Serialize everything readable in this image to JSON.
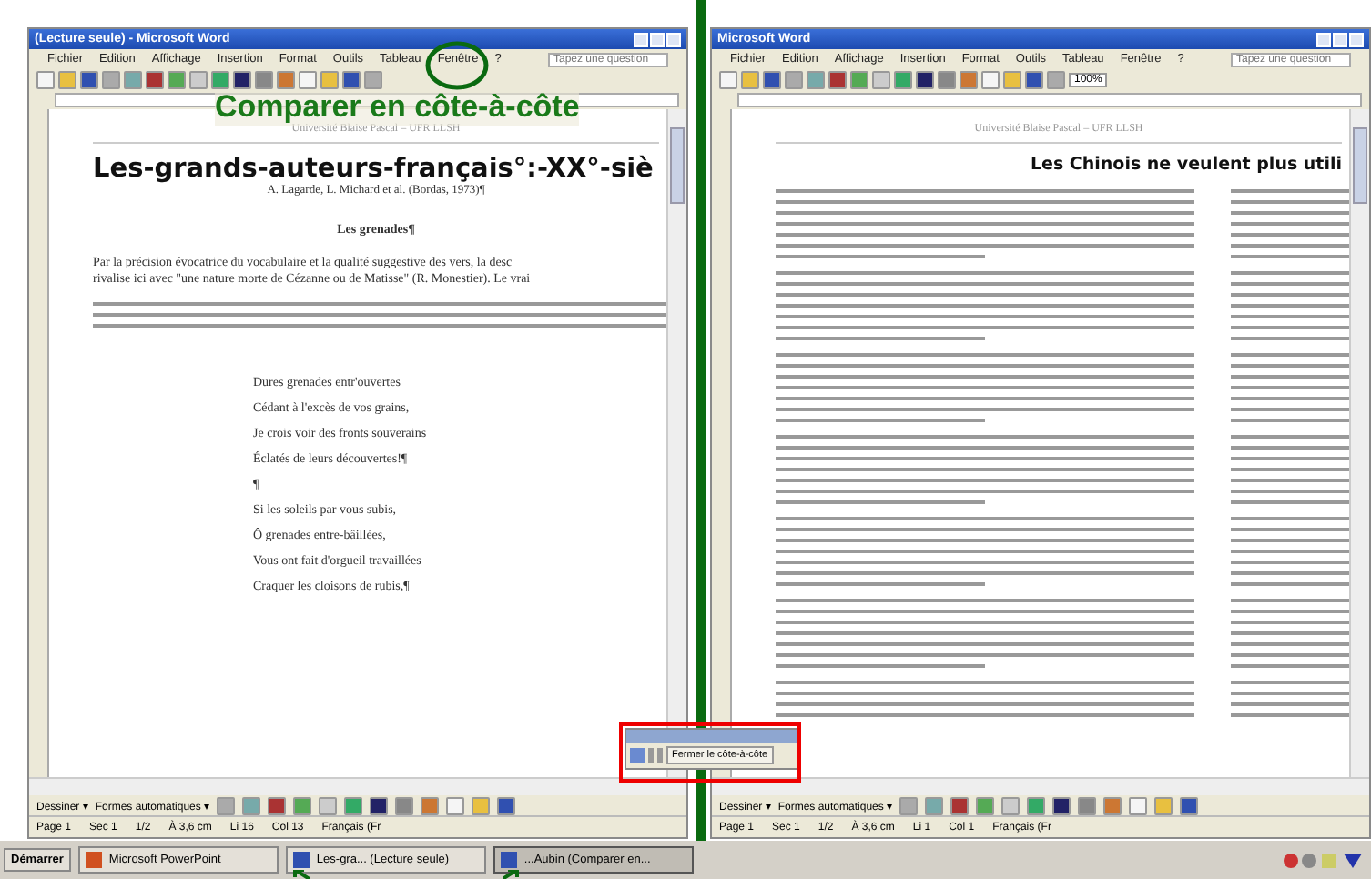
{
  "annotation": {
    "caption": "Comparer en côte-à-côte"
  },
  "windows": [
    {
      "title": "(Lecture seule) - Microsoft Word",
      "menus": [
        "Fichier",
        "Edition",
        "Affichage",
        "Insertion",
        "Format",
        "Outils",
        "Tableau",
        "Fenêtre",
        "?"
      ],
      "help_placeholder": "Tapez une question",
      "document": {
        "kind": "poem",
        "header": "Université Blaise Pascal – UFR LLSH",
        "title": "Les-grands-auteurs-français°:-XX°-siè",
        "subtitle": "A. Lagarde, L. Michard et al. (Bordas, 1973)¶",
        "heading": "Les grenades¶",
        "paragraph_lines": [
          "Par la précision évocatrice du vocabulaire et la qualité suggestive des vers, la desc",
          "rivalise ici avec \"une nature morte de Cézanne ou de Matisse\" (R. Monestier). Le vrai"
        ],
        "verses": [
          "Dures grenades entr'ouvertes",
          "Cédant à l'excès de vos grains,",
          "Je crois voir des fronts souverains",
          "Éclatés de leurs découvertes!¶",
          "¶",
          "Si les soleils par vous subis,",
          "Ô grenades entre-bâillées,",
          "Vous ont fait d'orgueil travaillées",
          "Craquer les cloisons de rubis,¶"
        ]
      },
      "drawing_toolbar": [
        "Dessiner ▾",
        "Formes automatiques ▾"
      ],
      "status": [
        "Page 1",
        "Sec 1",
        "1/2",
        "À 3,6 cm",
        "Li 16",
        "Col 13",
        "Français (Fr"
      ]
    },
    {
      "title": "Microsoft Word",
      "menus": [
        "Fichier",
        "Edition",
        "Affichage",
        "Insertion",
        "Format",
        "Outils",
        "Tableau",
        "Fenêtre",
        "?"
      ],
      "help_placeholder": "Tapez une question",
      "zoom": "100%",
      "document": {
        "kind": "article",
        "header": "Université Blaise Pascal – UFR LLSH",
        "title": "Les Chinois ne veulent plus utili"
      },
      "drawing_toolbar": [
        "Dessiner ▾",
        "Formes automatiques ▾"
      ],
      "status": [
        "Page 1",
        "Sec 1",
        "1/2",
        "À 3,6 cm",
        "Li 1",
        "Col 1",
        "Français (Fr"
      ]
    }
  ],
  "side_by_side_toolbar": {
    "button": "Fermer le côte-à-côte"
  },
  "taskbar": {
    "start": "Démarrer",
    "tasks": [
      {
        "label": "Microsoft PowerPoint",
        "selected": false
      },
      {
        "label": "Les-gra... (Lecture seule)",
        "selected": false
      },
      {
        "label": "...Aubin (Comparer en...",
        "selected": true
      }
    ]
  }
}
